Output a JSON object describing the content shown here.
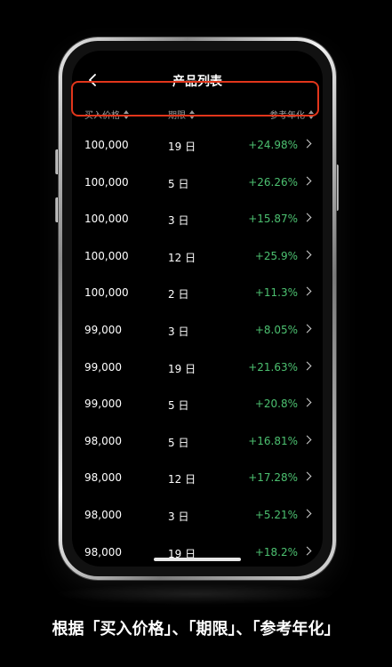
{
  "nav": {
    "title": "产品列表",
    "back_icon": "chevron-left-icon"
  },
  "columns": {
    "price": "买入价格",
    "term": "期限",
    "rate": "参考年化"
  },
  "rows": [
    {
      "price": "100,000",
      "term": "19 日",
      "rate": "+24.98%"
    },
    {
      "price": "100,000",
      "term": "5 日",
      "rate": "+26.26%"
    },
    {
      "price": "100,000",
      "term": "3 日",
      "rate": "+15.87%"
    },
    {
      "price": "100,000",
      "term": "12 日",
      "rate": "+25.9%"
    },
    {
      "price": "100,000",
      "term": "2 日",
      "rate": "+11.3%"
    },
    {
      "price": "99,000",
      "term": "3 日",
      "rate": "+8.05%"
    },
    {
      "price": "99,000",
      "term": "19 日",
      "rate": "+21.63%"
    },
    {
      "price": "99,000",
      "term": "5 日",
      "rate": "+20.8%"
    },
    {
      "price": "98,000",
      "term": "5 日",
      "rate": "+16.81%"
    },
    {
      "price": "98,000",
      "term": "12 日",
      "rate": "+17.28%"
    },
    {
      "price": "98,000",
      "term": "3 日",
      "rate": "+5.21%"
    },
    {
      "price": "98,000",
      "term": "19 日",
      "rate": "+18.2%"
    }
  ],
  "caption": "根据「买入价格」、「期限」、「参考年化」",
  "colors": {
    "positive": "#4cc070",
    "highlight": "#e2361b",
    "background": "#000000"
  }
}
